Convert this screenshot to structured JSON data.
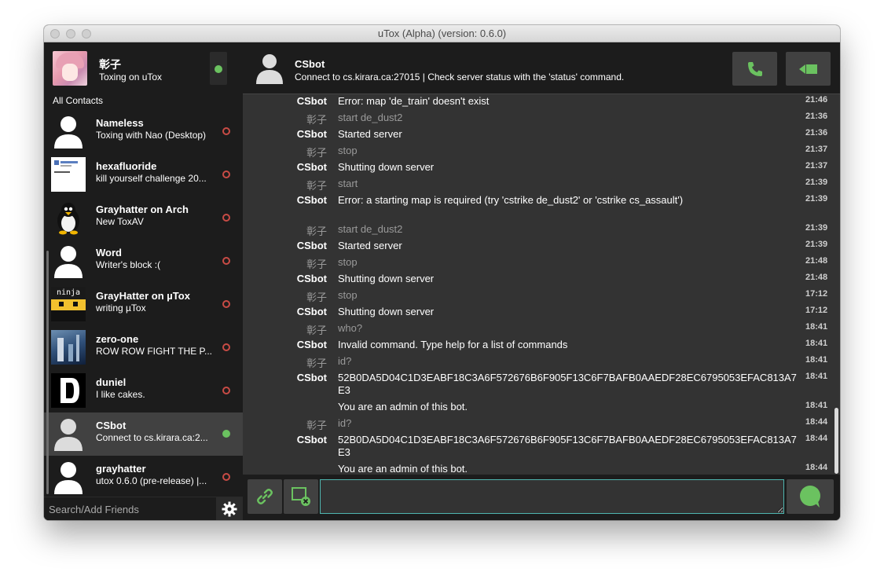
{
  "window": {
    "title": "uTox (Alpha) (version: 0.6.0)"
  },
  "self": {
    "name": "彰子",
    "status": "Toxing on uTox",
    "status_color": "#6bc260"
  },
  "sidebar": {
    "filter_label": "All Contacts",
    "search_placeholder": "Search/Add Friends",
    "contacts": [
      {
        "name": "Nameless",
        "status_msg": "Toxing with Nao (Desktop)",
        "online": false,
        "avatar": "default-person"
      },
      {
        "name": "hexafluoride",
        "status_msg": "kill yourself challenge 20...",
        "online": false,
        "avatar": "screenshot-thumb"
      },
      {
        "name": "Grayhatter on Arch",
        "status_msg": "New ToxAV",
        "online": false,
        "avatar": "tux-penguin"
      },
      {
        "name": "Word",
        "status_msg": "Writer's block :(",
        "online": false,
        "avatar": "default-person"
      },
      {
        "name": "GrayHatter on µTox",
        "status_msg": "writing µTox",
        "online": false,
        "avatar": "ninja-cat"
      },
      {
        "name": "zero-one",
        "status_msg": "ROW ROW FIGHT THE P...",
        "online": false,
        "avatar": "blue-scene"
      },
      {
        "name": "duniel",
        "status_msg": "I like cakes.",
        "online": false,
        "avatar": "pixel-d"
      },
      {
        "name": "CSbot",
        "status_msg": "Connect to cs.kirara.ca:2...",
        "online": true,
        "avatar": "default-person",
        "active": true
      },
      {
        "name": "grayhatter",
        "status_msg": "utox 0.6.0 (pre-release) |...",
        "online": false,
        "avatar": "default-person"
      }
    ]
  },
  "chat": {
    "name": "CSbot",
    "status": "Connect to cs.kirara.ca:27015 | Check server status with the 'status' command.",
    "call_icon": "phone-icon",
    "video_icon": "video-icon",
    "messages": [
      {
        "author": "CSbot",
        "self": false,
        "text": "Error: map 'de_train' doesn't exist",
        "time": "21:46"
      },
      {
        "author": "彰子",
        "self": true,
        "text": "start de_dust2",
        "time": "21:36"
      },
      {
        "author": "CSbot",
        "self": false,
        "text": "Started server",
        "time": "21:36"
      },
      {
        "author": "彰子",
        "self": true,
        "text": "stop",
        "time": "21:37"
      },
      {
        "author": "CSbot",
        "self": false,
        "text": "Shutting down server",
        "time": "21:37"
      },
      {
        "author": "彰子",
        "self": true,
        "text": "start",
        "time": "21:39"
      },
      {
        "author": "CSbot",
        "self": false,
        "text": "Error: a starting map is required (try 'cstrike de_dust2' or 'cstrike cs_assault')",
        "time": "21:39"
      },
      {
        "author": "彰子",
        "self": true,
        "text": "start de_dust2",
        "time": "21:39"
      },
      {
        "author": "CSbot",
        "self": false,
        "text": "Started server",
        "time": "21:39"
      },
      {
        "author": "彰子",
        "self": true,
        "text": "stop",
        "time": "21:48"
      },
      {
        "author": "CSbot",
        "self": false,
        "text": "Shutting down server",
        "time": "21:48"
      },
      {
        "author": "彰子",
        "self": true,
        "text": "stop",
        "time": "17:12"
      },
      {
        "author": "CSbot",
        "self": false,
        "text": "Shutting down server",
        "time": "17:12"
      },
      {
        "author": "彰子",
        "self": true,
        "text": "who?",
        "time": "18:41"
      },
      {
        "author": "CSbot",
        "self": false,
        "text": "Invalid command. Type help for a list of commands",
        "time": "18:41"
      },
      {
        "author": "彰子",
        "self": true,
        "text": "id?",
        "time": "18:41"
      },
      {
        "author": "CSbot",
        "self": false,
        "text": "52B0DA5D04C1D3EABF18C3A6F572676B6F905F13C6F7BAFB0AAEDF28EC6795053EFAC813A7E3",
        "time": "18:41"
      },
      {
        "author": "",
        "self": false,
        "text": "You are an admin of this bot.",
        "time": "18:41"
      },
      {
        "author": "彰子",
        "self": true,
        "text": "id?",
        "time": "18:44"
      },
      {
        "author": "CSbot",
        "self": false,
        "text": "52B0DA5D04C1D3EABF18C3A6F572676B6F905F13C6F7BAFB0AAEDF28EC6795053EFAC813A7E3",
        "time": "18:44"
      },
      {
        "author": "",
        "self": false,
        "text": "You are an admin of this bot.",
        "time": "18:44"
      }
    ]
  },
  "compose": {
    "value": "",
    "attach_icon": "paperclip-icon",
    "screenshot_icon": "screenshot-icon",
    "send_icon": "chat-bubble-icon"
  },
  "colors": {
    "accent_green": "#6bc260",
    "offline_red": "#c84b45",
    "input_border": "#4fb6b0"
  }
}
